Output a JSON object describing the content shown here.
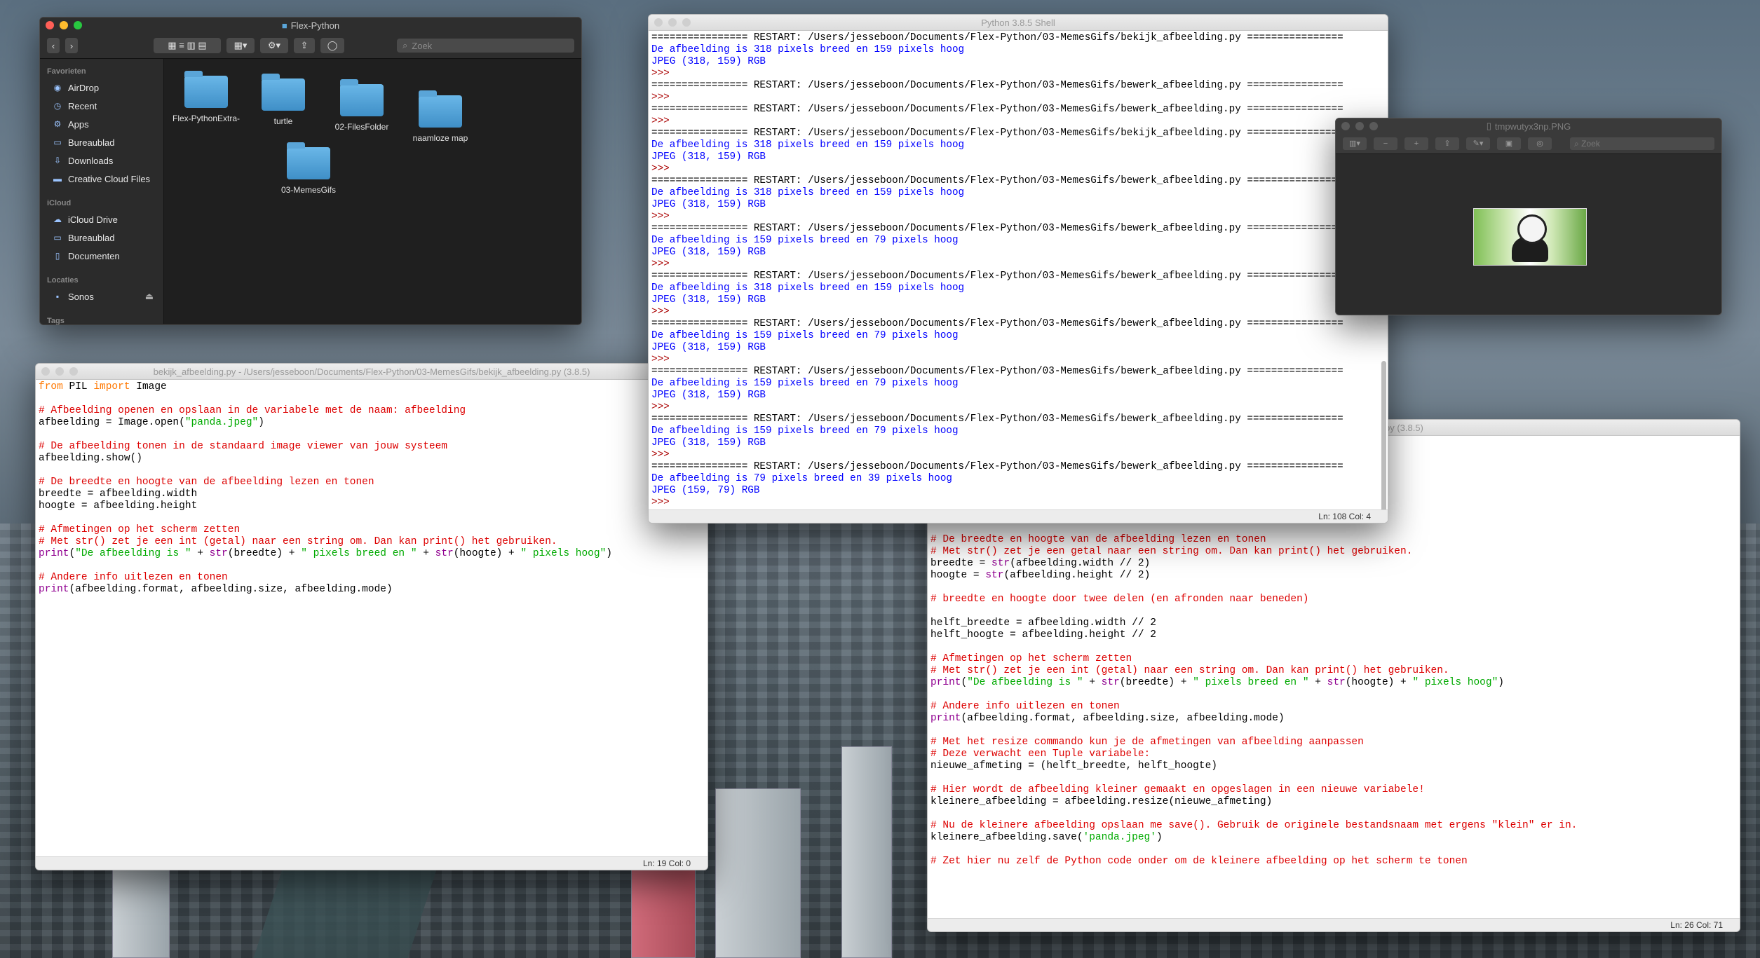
{
  "finder": {
    "title": "Flex-Python",
    "search_placeholder": "Zoek",
    "sections": {
      "favorites": "Favorieten",
      "icloud": "iCloud",
      "locations": "Locaties",
      "tags": "Tags"
    },
    "favorites": [
      "AirDrop",
      "Recent",
      "Apps",
      "Bureaublad",
      "Downloads",
      "Creative Cloud Files"
    ],
    "icloud_items": [
      "iCloud Drive",
      "Bureaublad",
      "Documenten"
    ],
    "location_items": [
      "Sonos"
    ],
    "folders": [
      "Flex-PythonExtra-",
      "turtle",
      "02-FilesFolder",
      "naamloze map",
      "03-MemesGifs"
    ]
  },
  "editor_left": {
    "title": "bekijk_afbeelding.py - /Users/jesseboon/Documents/Flex-Python/03-MemesGifs/bekijk_afbeelding.py (3.8.5)",
    "status": "Ln: 19   Col: 0"
  },
  "editor_right": {
    "title": "03-MemesGifs/bewerk_afbeelding.py (3.8.5)",
    "status": "Ln: 26   Col: 71"
  },
  "shell": {
    "title": "Python 3.8.5 Shell",
    "status": "Ln: 108    Col: 4"
  },
  "preview": {
    "title": "tmpwutyx3np.PNG",
    "search_placeholder": "Zoek"
  }
}
